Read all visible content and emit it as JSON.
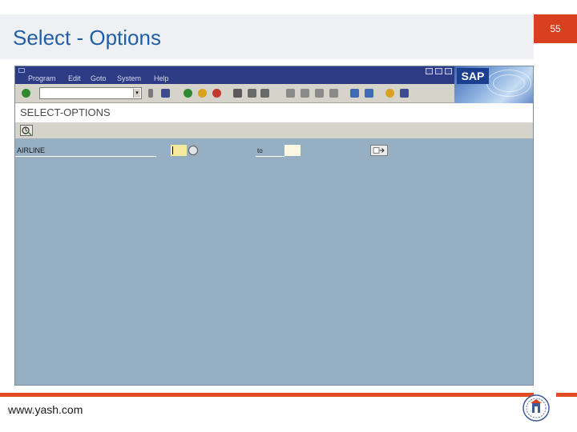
{
  "slide": {
    "title": "Select - Options",
    "page_number": "55",
    "footer_url": "www.yash.com"
  },
  "sap": {
    "logo_text": "SAP",
    "menu": [
      "Program",
      "Edit",
      "Goto",
      "System",
      "Help"
    ],
    "screen_title": "SELECT-OPTIONS",
    "command_field_value": "",
    "selection": {
      "label": "AIRLINE",
      "low_value": "",
      "to_label": "to",
      "high_value": ""
    }
  },
  "colors": {
    "accent_orange": "#e24a22",
    "title_blue": "#1f5fa8",
    "sap_background": "#97afc2",
    "menubar": "#2d3a84"
  }
}
